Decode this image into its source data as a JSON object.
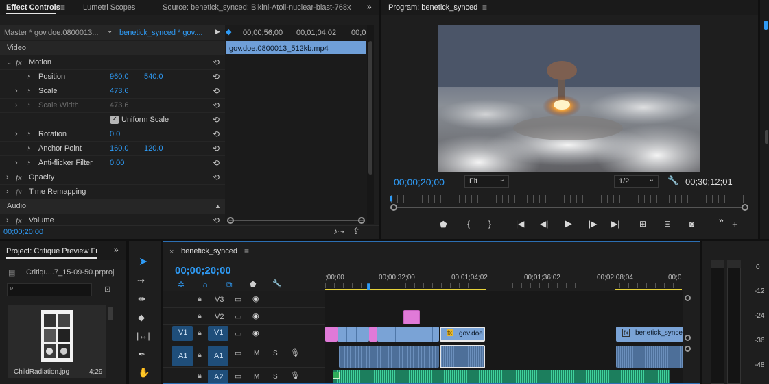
{
  "effect_controls": {
    "tabs": [
      "Effect Controls",
      "Lumetri Scopes",
      "Source: benetick_synced: Bikini-Atoll-nuclear-blast-768x"
    ],
    "source_master": "Master * gov.doe.0800013...",
    "source_seq": "benetick_synced * gov....",
    "mini_timecodes": [
      "00;00;56;00",
      "00;01;04;02",
      "00;0"
    ],
    "mini_clip": "gov.doe.0800013_512kb.mp4",
    "section_video": "Video",
    "section_audio": "Audio",
    "motion": "Motion",
    "position_label": "Position",
    "position_x": "960.0",
    "position_y": "540.0",
    "scale_label": "Scale",
    "scale_val": "473.6",
    "scale_width_label": "Scale Width",
    "scale_width_val": "473.6",
    "uniform_scale": "Uniform Scale",
    "rotation_label": "Rotation",
    "rotation_val": "0.0",
    "anchor_label": "Anchor Point",
    "anchor_x": "160.0",
    "anchor_y": "120.0",
    "antiflicker_label": "Anti-flicker Filter",
    "antiflicker_val": "0.00",
    "opacity": "Opacity",
    "time_remap": "Time Remapping",
    "volume": "Volume",
    "timecode": "00;00;20;00"
  },
  "program": {
    "title": "Program: benetick_synced",
    "timecode": "00;00;20;00",
    "fit": "Fit",
    "resolution": "1/2",
    "duration": "00;30;12;01"
  },
  "project": {
    "title": "Project: Critique Preview Fi",
    "file": "Critiqu...7_15-09-50.prproj",
    "search_placeholder": "",
    "item_name": "ChildRadiation.jpg",
    "item_duration": "4;29"
  },
  "timeline": {
    "tab": "benetick_synced",
    "timecode": "00;00;20;00",
    "ruler": [
      ";00;00",
      "00;00;32;00",
      "00;01;04;02",
      "00;01;36;02",
      "00;02;08;04",
      "00;0"
    ],
    "tracks": [
      {
        "src": "",
        "name": "V3"
      },
      {
        "src": "",
        "name": "V2"
      },
      {
        "src": "V1",
        "name": "V1"
      },
      {
        "src": "A1",
        "name": "A1"
      },
      {
        "src": "",
        "name": "A2"
      }
    ],
    "clip_gov": "gov.doe.",
    "clip_bene": "benetick_synced",
    "m_label": "M",
    "s_label": "S"
  },
  "meter": {
    "labels": [
      "0",
      "-12",
      "-24",
      "-36",
      "-48"
    ]
  },
  "colors": {
    "accent": "#2f9bf5",
    "clip_blue": "#7aa3d6",
    "clip_pink": "#e07ad8",
    "audio_green": "#1fa67a",
    "audio_blue": "#4d6f99"
  }
}
